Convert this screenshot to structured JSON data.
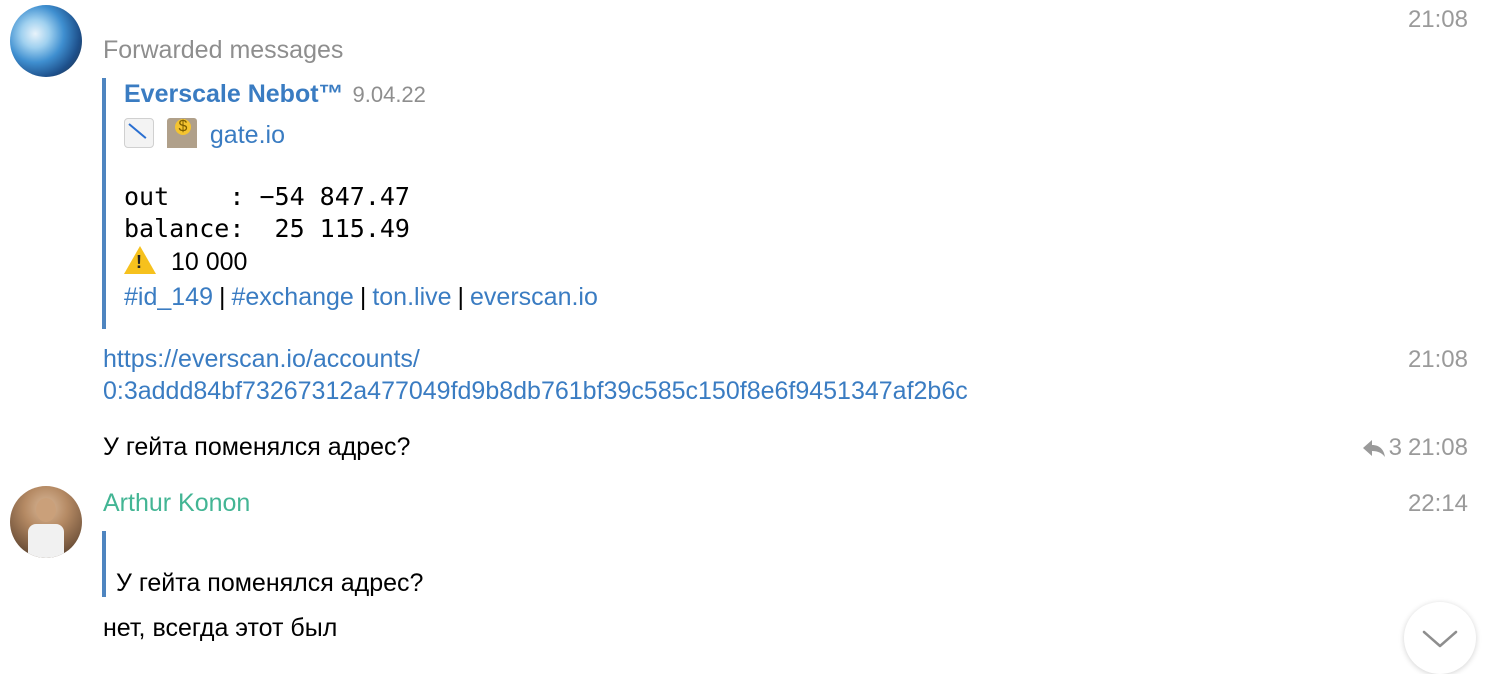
{
  "message1": {
    "time": "21:08",
    "forwarded_header": "Forwarded messages",
    "quote": {
      "author": "Everscale Nebot™",
      "date": "9.04.22",
      "link": "gate.io",
      "out_line": "out    : −54 847.47",
      "balance_line": "balance:  25 115.49",
      "warn_value": "10 000",
      "tags": [
        "#id_149",
        "#exchange",
        "ton.live",
        "everscan.io"
      ],
      "separator": "|"
    }
  },
  "message2": {
    "time": "21:08",
    "url_line1": "https://everscan.io/accounts/",
    "url_line2": "0:3addd84bf73267312a477049fd9b8db761bf39c585c150f8e6f9451347af2b6c"
  },
  "message3": {
    "text": "У гейта поменялся адрес?",
    "reply_count": "3",
    "time": "21:08"
  },
  "message4": {
    "author": "Arthur Konon",
    "time": "22:14",
    "quoted_text": "У гейта поменялся адрес?",
    "text": "нет, всегда этот был"
  },
  "icons": {
    "scroll_down": "chevron-down-icon",
    "reply": "reply-icon",
    "warning": "warning-emoji",
    "chart": "chart-decreasing-emoji",
    "bank": "bank-emoji"
  },
  "colors": {
    "link": "#3a7cc2",
    "author2": "#43b594",
    "quote_bar": "#4e85c0",
    "meta": "#9a9a9a"
  }
}
